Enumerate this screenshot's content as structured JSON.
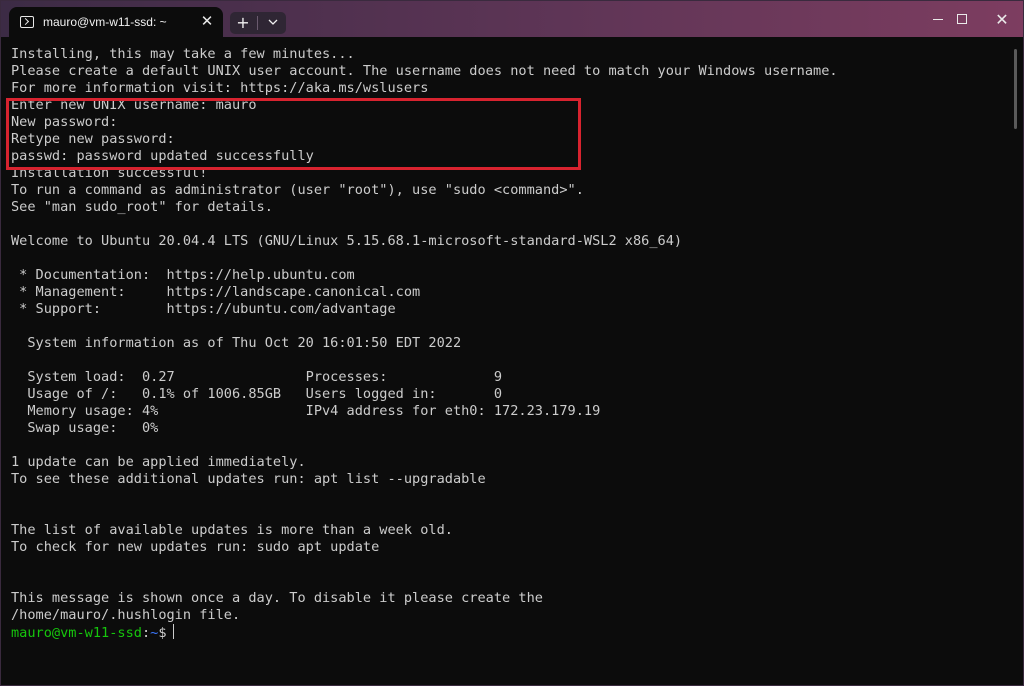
{
  "window": {
    "tab_title": "mauro@vm-w11-ssd: ~",
    "tab_close": "✕",
    "new_tab": "+",
    "dropdown": "⌄",
    "minimize": "",
    "maximize": "",
    "close": "✕"
  },
  "terminal": {
    "lines": [
      "Installing, this may take a few minutes...",
      "Please create a default UNIX user account. The username does not need to match your Windows username.",
      "For more information visit: https://aka.ms/wslusers",
      "Enter new UNIX username: mauro",
      "New password:",
      "Retype new password:",
      "passwd: password updated successfully",
      "Installation successful!",
      "To run a command as administrator (user \"root\"), use \"sudo <command>\".",
      "See \"man sudo_root\" for details.",
      "",
      "Welcome to Ubuntu 20.04.4 LTS (GNU/Linux 5.15.68.1-microsoft-standard-WSL2 x86_64)",
      "",
      " * Documentation:  https://help.ubuntu.com",
      " * Management:     https://landscape.canonical.com",
      " * Support:        https://ubuntu.com/advantage",
      "",
      "  System information as of Thu Oct 20 16:01:50 EDT 2022",
      "",
      "  System load:  0.27                Processes:             9",
      "  Usage of /:   0.1% of 1006.85GB   Users logged in:       0",
      "  Memory usage: 4%                  IPv4 address for eth0: 172.23.179.19",
      "  Swap usage:   0%",
      "",
      "1 update can be applied immediately.",
      "To see these additional updates run: apt list --upgradable",
      "",
      "",
      "The list of available updates is more than a week old.",
      "To check for new updates run: sudo apt update",
      "",
      "",
      "This message is shown once a day. To disable it please create the",
      "/home/mauro/.hushlogin file."
    ],
    "prompt_user": "mauro@vm-w11-ssd",
    "prompt_colon": ":",
    "prompt_path": "~",
    "prompt_symbol": "$"
  },
  "colors": {
    "highlight_box": "#d8232f",
    "prompt_user": "#16c60c",
    "prompt_path": "#3b78ff",
    "terminal_bg": "#0c0c0c",
    "terminal_fg": "#cccccc"
  }
}
